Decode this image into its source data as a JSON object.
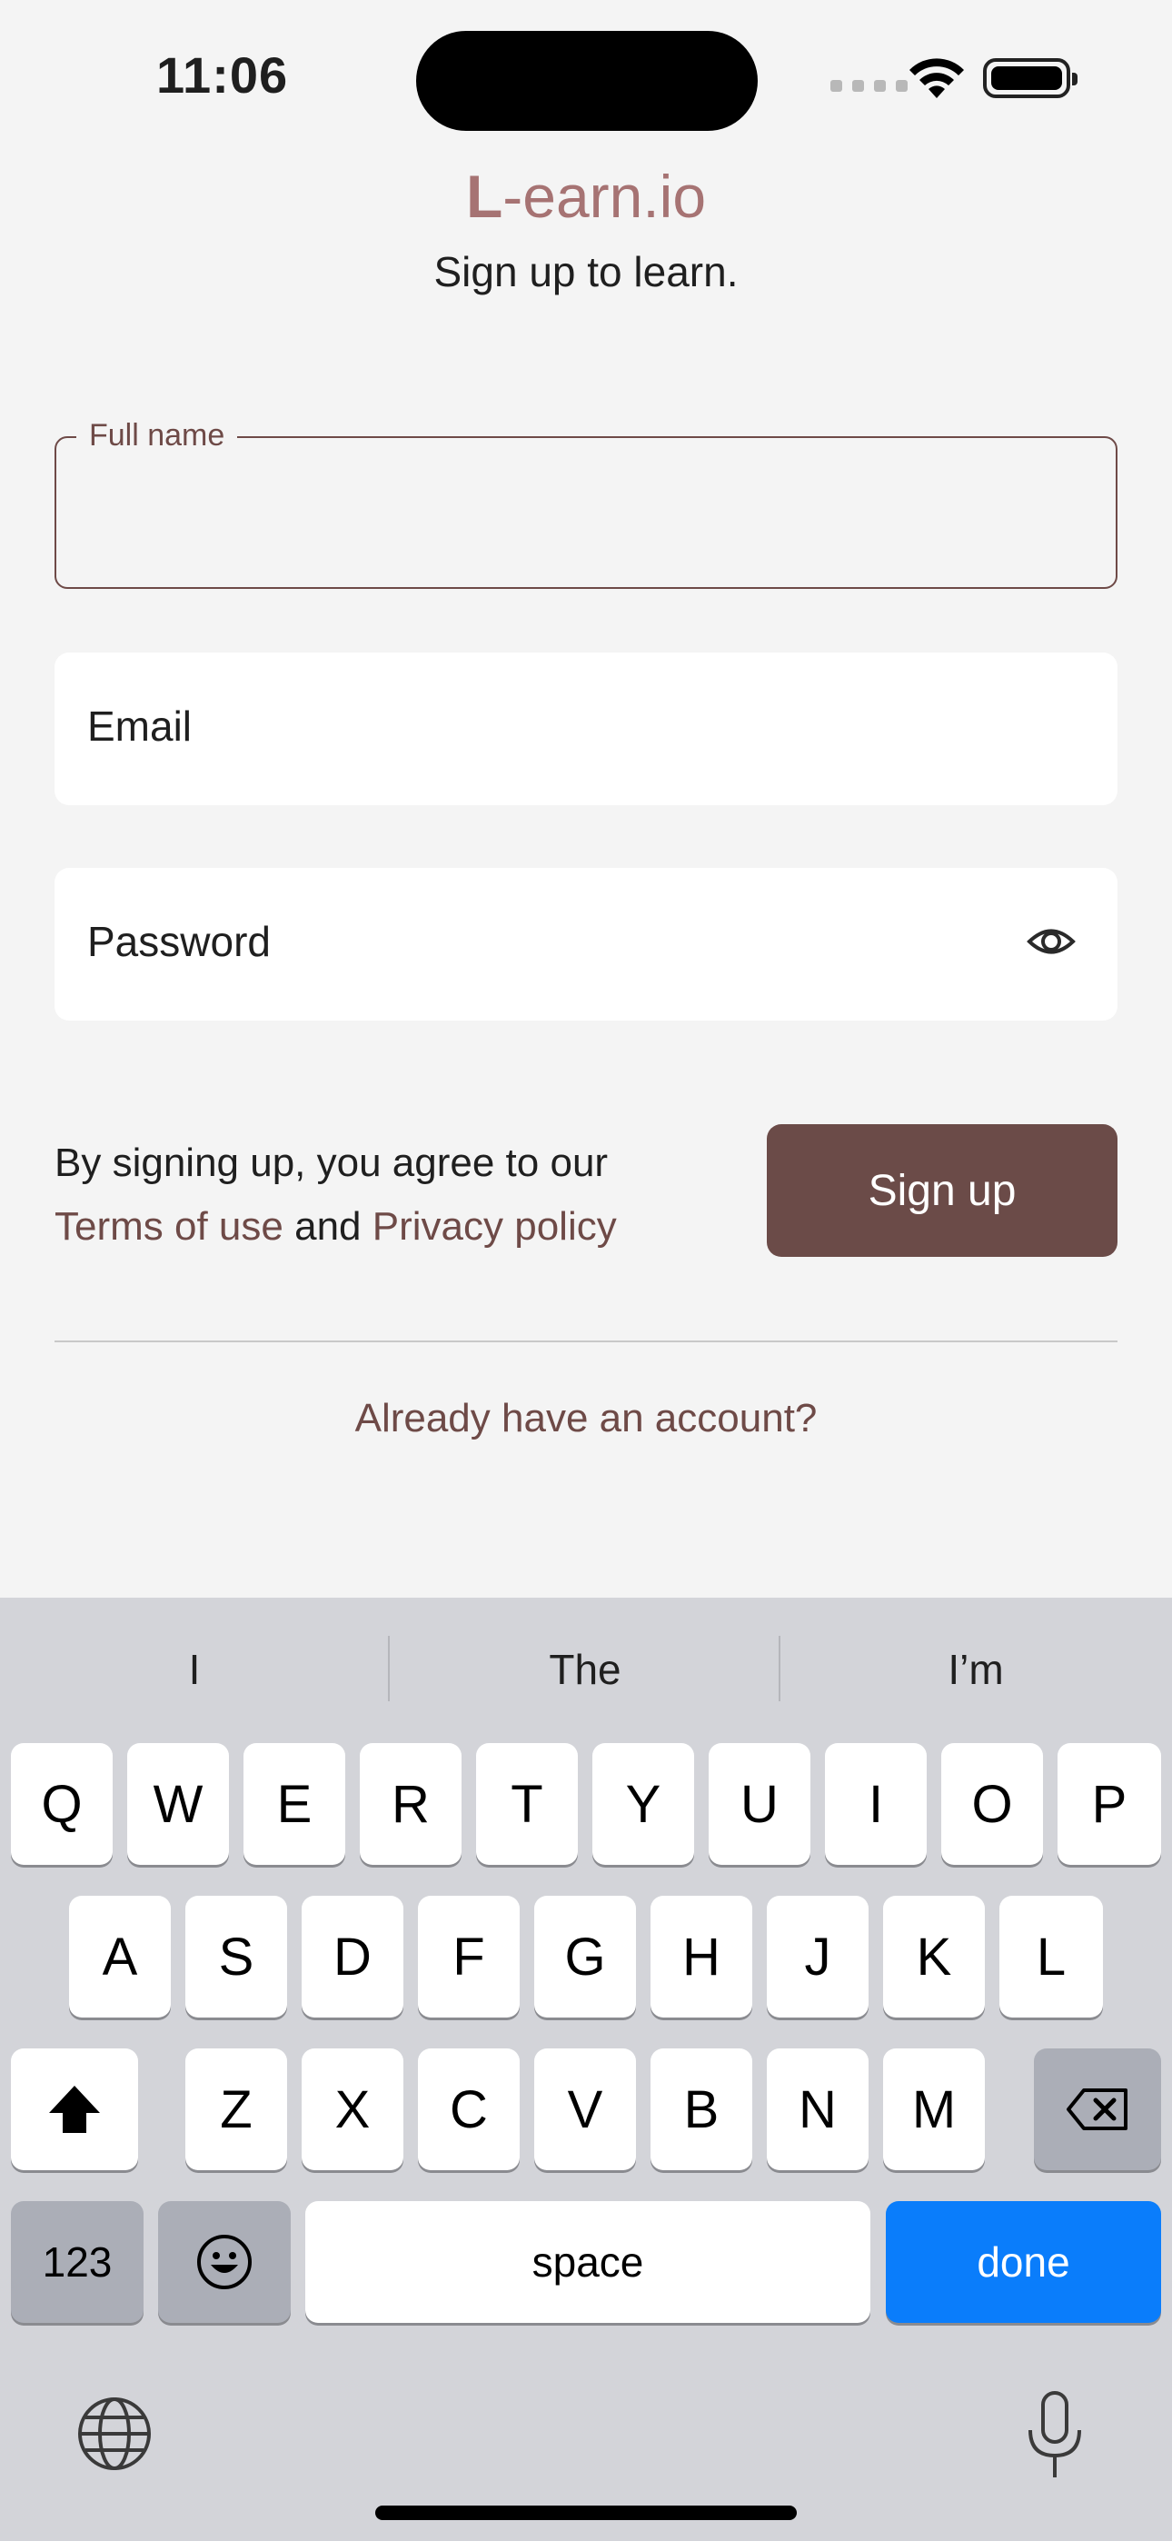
{
  "status_bar": {
    "time": "11:06"
  },
  "header": {
    "brand_initial": "L",
    "brand_rest": "-earn.io",
    "subtitle": "Sign up to learn."
  },
  "form": {
    "full_name_label": "Full name",
    "email_placeholder": "Email",
    "password_placeholder": "Password",
    "terms_prefix": "By signing up, you agree to our",
    "terms_link": "Terms of use",
    "terms_and": "and",
    "privacy_link": "Privacy policy",
    "signup_label": "Sign up",
    "login_link": "Already have an account?"
  },
  "keyboard": {
    "suggestions": [
      "I",
      "The",
      "I’m"
    ],
    "row1": [
      "Q",
      "W",
      "E",
      "R",
      "T",
      "Y",
      "U",
      "I",
      "O",
      "P"
    ],
    "row2": [
      "A",
      "S",
      "D",
      "F",
      "G",
      "H",
      "J",
      "K",
      "L"
    ],
    "row3": [
      "Z",
      "X",
      "C",
      "V",
      "B",
      "N",
      "M"
    ],
    "numbers_label": "123",
    "space_label": "space",
    "done_label": "done"
  },
  "colors": {
    "accent": "#6b4b48",
    "brand": "#a67373",
    "keyboard_done": "#0a7dfb"
  }
}
